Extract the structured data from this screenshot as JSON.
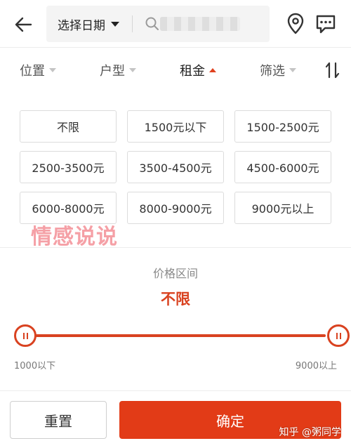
{
  "header": {
    "date_select_label": "选择日期",
    "search_placeholder": ""
  },
  "filters": {
    "tabs": [
      {
        "label": "位置",
        "active": false
      },
      {
        "label": "户型",
        "active": false
      },
      {
        "label": "租金",
        "active": true
      },
      {
        "label": "筛选",
        "active": false
      }
    ]
  },
  "price_options": [
    "不限",
    "1500元以下",
    "1500-2500元",
    "2500-3500元",
    "3500-4500元",
    "4500-6000元",
    "6000-8000元",
    "8000-9000元",
    "9000元以上"
  ],
  "watermark": "情感说说",
  "price_range": {
    "title": "价格区间",
    "value_label": "不限",
    "min_label": "1000以下",
    "max_label": "9000以上",
    "selected_min_fraction": 0.0,
    "selected_max_fraction": 1.0
  },
  "footer": {
    "reset_label": "重置",
    "confirm_label": "确定",
    "credit": "知乎 @粥同学"
  },
  "colors": {
    "accent": "#d94220",
    "confirm_bg": "#e23b17",
    "watermark": "#f5a0a6"
  }
}
